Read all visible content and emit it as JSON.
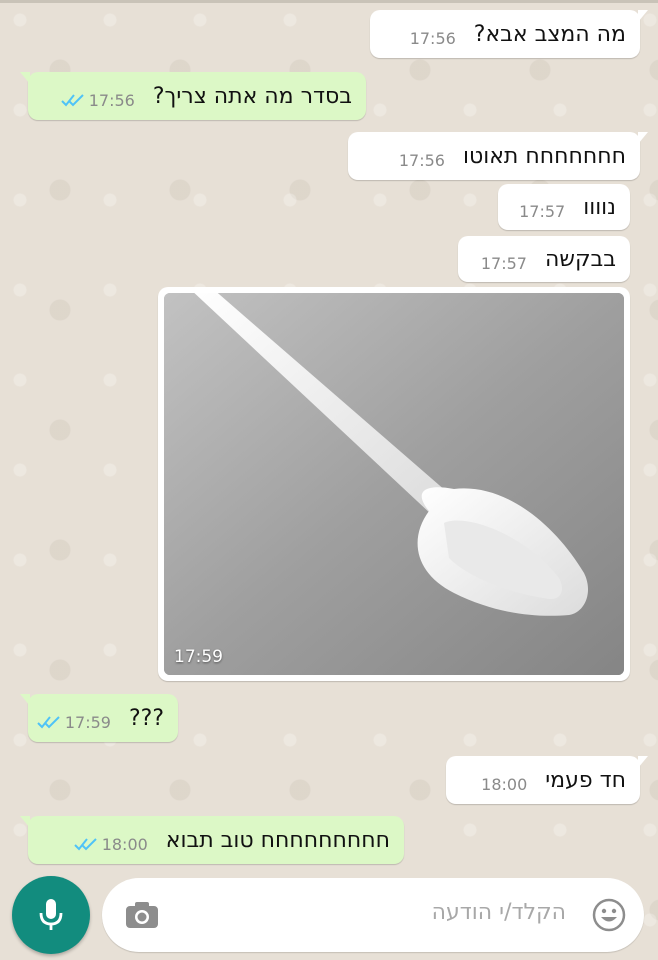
{
  "messages": [
    {
      "text": "מה המצב אבא?",
      "time": "17:56"
    },
    {
      "text": "בסדר מה אתה צריך?",
      "time": "17:56"
    },
    {
      "text": "חחחחחחח תאוטו",
      "time": "17:56"
    },
    {
      "text": "נוווו",
      "time": "17:57"
    },
    {
      "text": "בבקשה",
      "time": "17:57"
    },
    {
      "time": "17:59"
    },
    {
      "text": "???",
      "time": "17:59"
    },
    {
      "text": "חד פעמי",
      "time": "18:00"
    },
    {
      "text": "חחחחחחחחח טוב תבוא",
      "time": "18:00"
    }
  ],
  "composer": {
    "placeholder": "הקלד/י הודעה"
  },
  "colors": {
    "incoming": "#ffffff",
    "outgoing": "#dcf8c6",
    "accent": "#128c7e",
    "read_ticks": "#4fc3f7"
  },
  "icons": {
    "emoji": "emoji-icon",
    "camera": "camera-icon",
    "mic": "mic-icon",
    "read": "double-check-icon"
  }
}
